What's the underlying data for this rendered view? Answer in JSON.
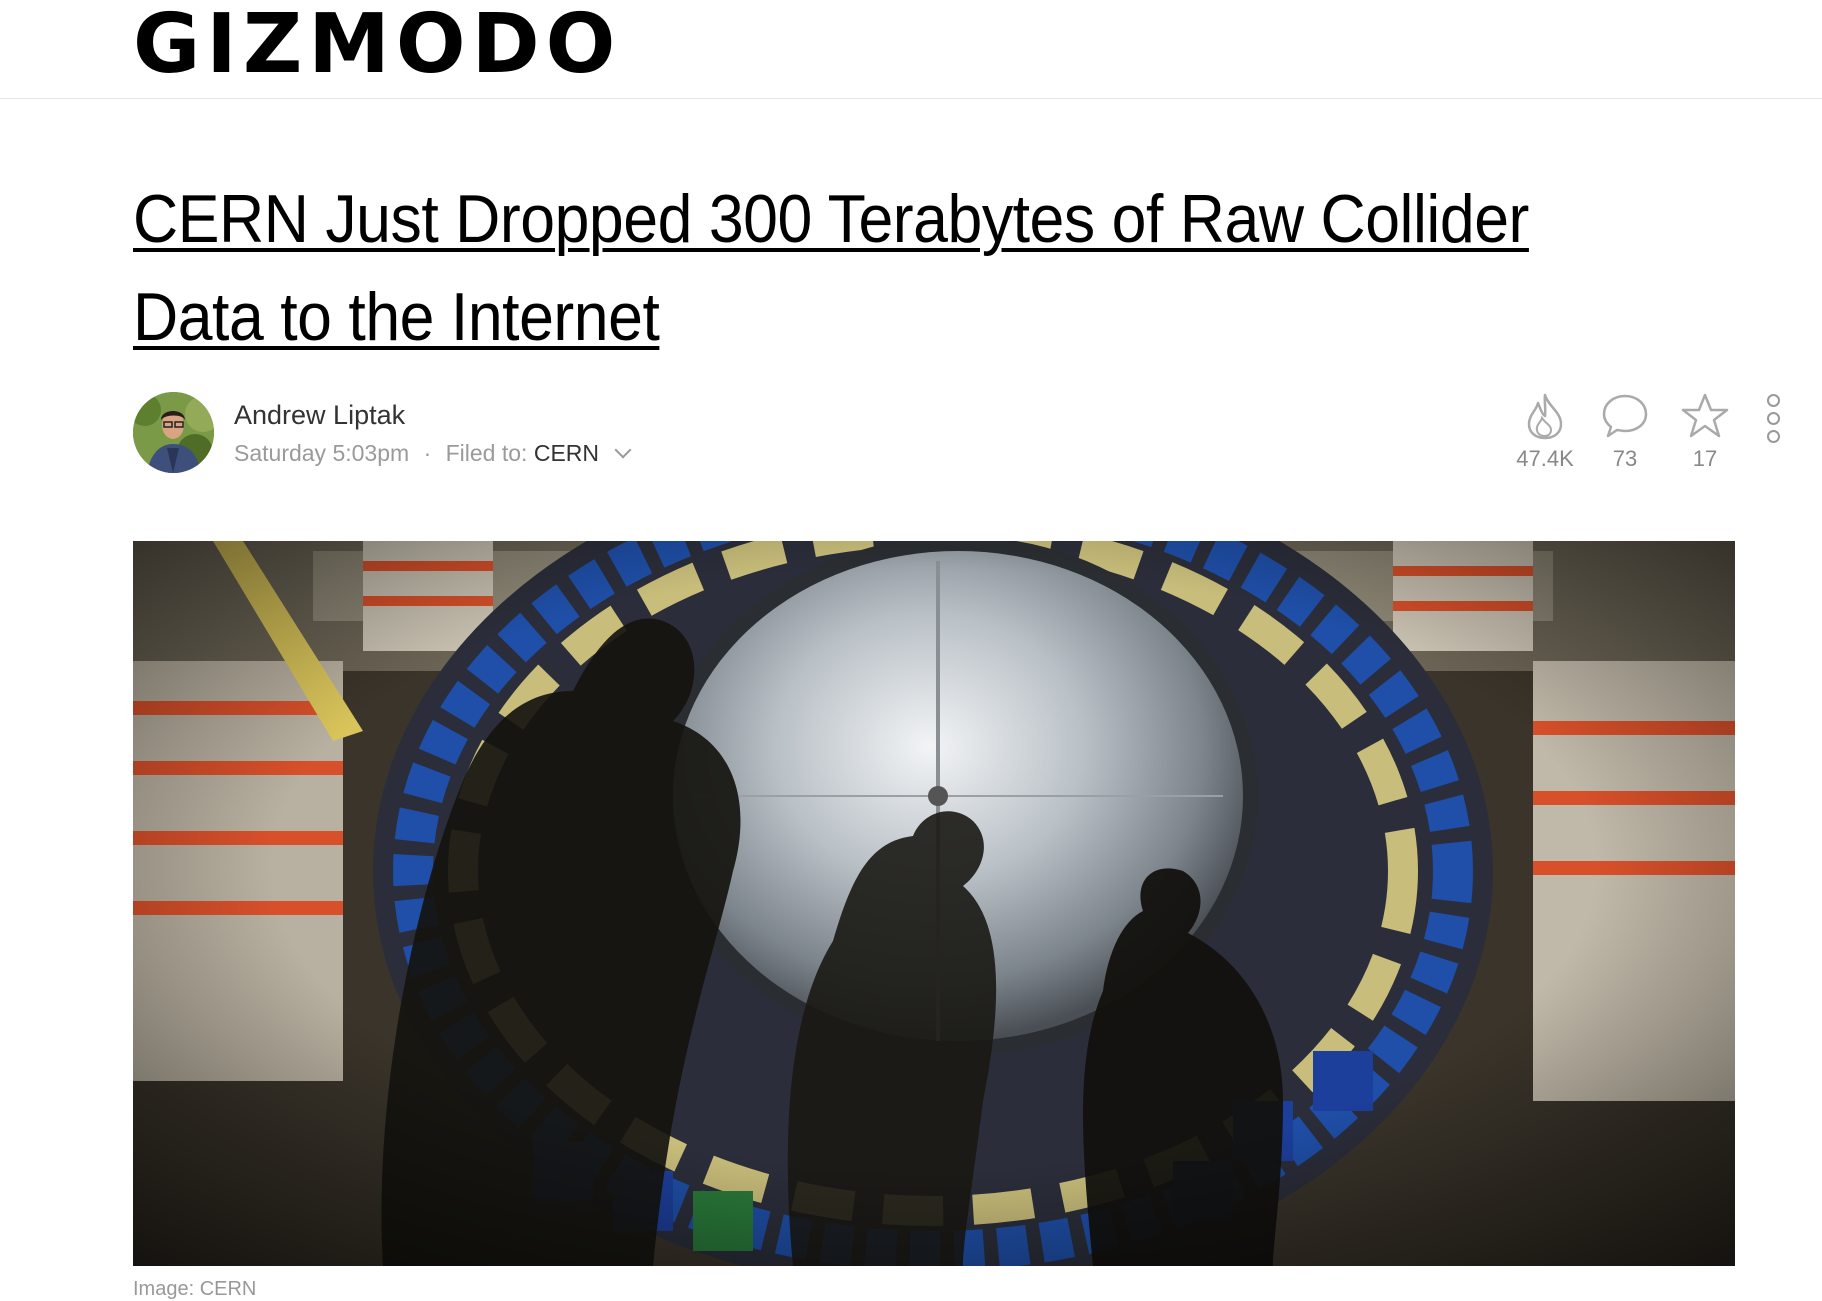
{
  "site": {
    "logo": "GIZMODO"
  },
  "article": {
    "title": "CERN Just Dropped 300 Terabytes of Raw Collider Data to the Internet",
    "author": "Andrew Liptak",
    "date": "Saturday 5:03pm",
    "filed_label": "Filed to:",
    "filed_category": "CERN",
    "separator": "·"
  },
  "stats": {
    "views": "47.4K",
    "comments": "73",
    "stars": "17"
  },
  "icons": [
    "flame-icon",
    "comment-icon",
    "star-icon",
    "more-options-icon",
    "chevron-down-icon"
  ],
  "hero": {
    "caption": "Image: CERN"
  }
}
